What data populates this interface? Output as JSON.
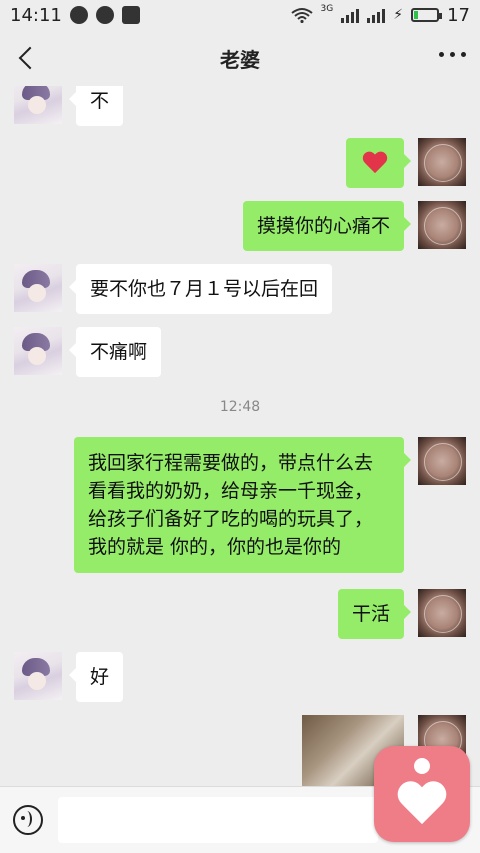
{
  "status_bar": {
    "time": "14:11",
    "network": "3G",
    "battery_label": "17",
    "battery_level": 0.17,
    "icons": [
      "message-icon",
      "app-icon",
      "image-icon",
      "wifi-icon",
      "signal-icon",
      "charging-icon",
      "battery-icon"
    ]
  },
  "header": {
    "title": "老婆",
    "back_icon": "chevron-left-icon",
    "more_icon": "more-dots-icon"
  },
  "messages": [
    {
      "side": "left",
      "text": "不"
    },
    {
      "side": "right",
      "type": "emoji",
      "emoji": "heart",
      "color": "#e2354a"
    },
    {
      "side": "right",
      "text": "摸摸你的心痛不"
    },
    {
      "side": "left",
      "text": "要不你也７月１号以后在回"
    },
    {
      "side": "left",
      "text": "不痛啊"
    },
    {
      "type": "time",
      "text": "12:48"
    },
    {
      "side": "right",
      "text": "我回家行程需要做的，带点什么去看看我的奶奶，给母亲一千现金，给孩子们备好了吃的喝的玩具了，我的就是 你的，你的也是你的",
      "lines": [
        "我回家行程需要做的，带点什么去",
        "看看我的奶奶，给母亲一千现金，",
        "给孩子们备好了吃的喝的玩具了，",
        "我的就是 你的，你的也是你的"
      ]
    },
    {
      "side": "right",
      "text": "干活"
    },
    {
      "side": "left",
      "text": "好"
    },
    {
      "side": "right",
      "type": "image"
    }
  ],
  "input_bar": {
    "voice_icon": "voice-icon",
    "text_value": ""
  },
  "floating_app": {
    "icon": "heart-app-icon",
    "color": "#ef7d88"
  },
  "colors": {
    "background": "#ededed",
    "bubble_self": "#95ec69",
    "bubble_other": "#ffffff"
  }
}
